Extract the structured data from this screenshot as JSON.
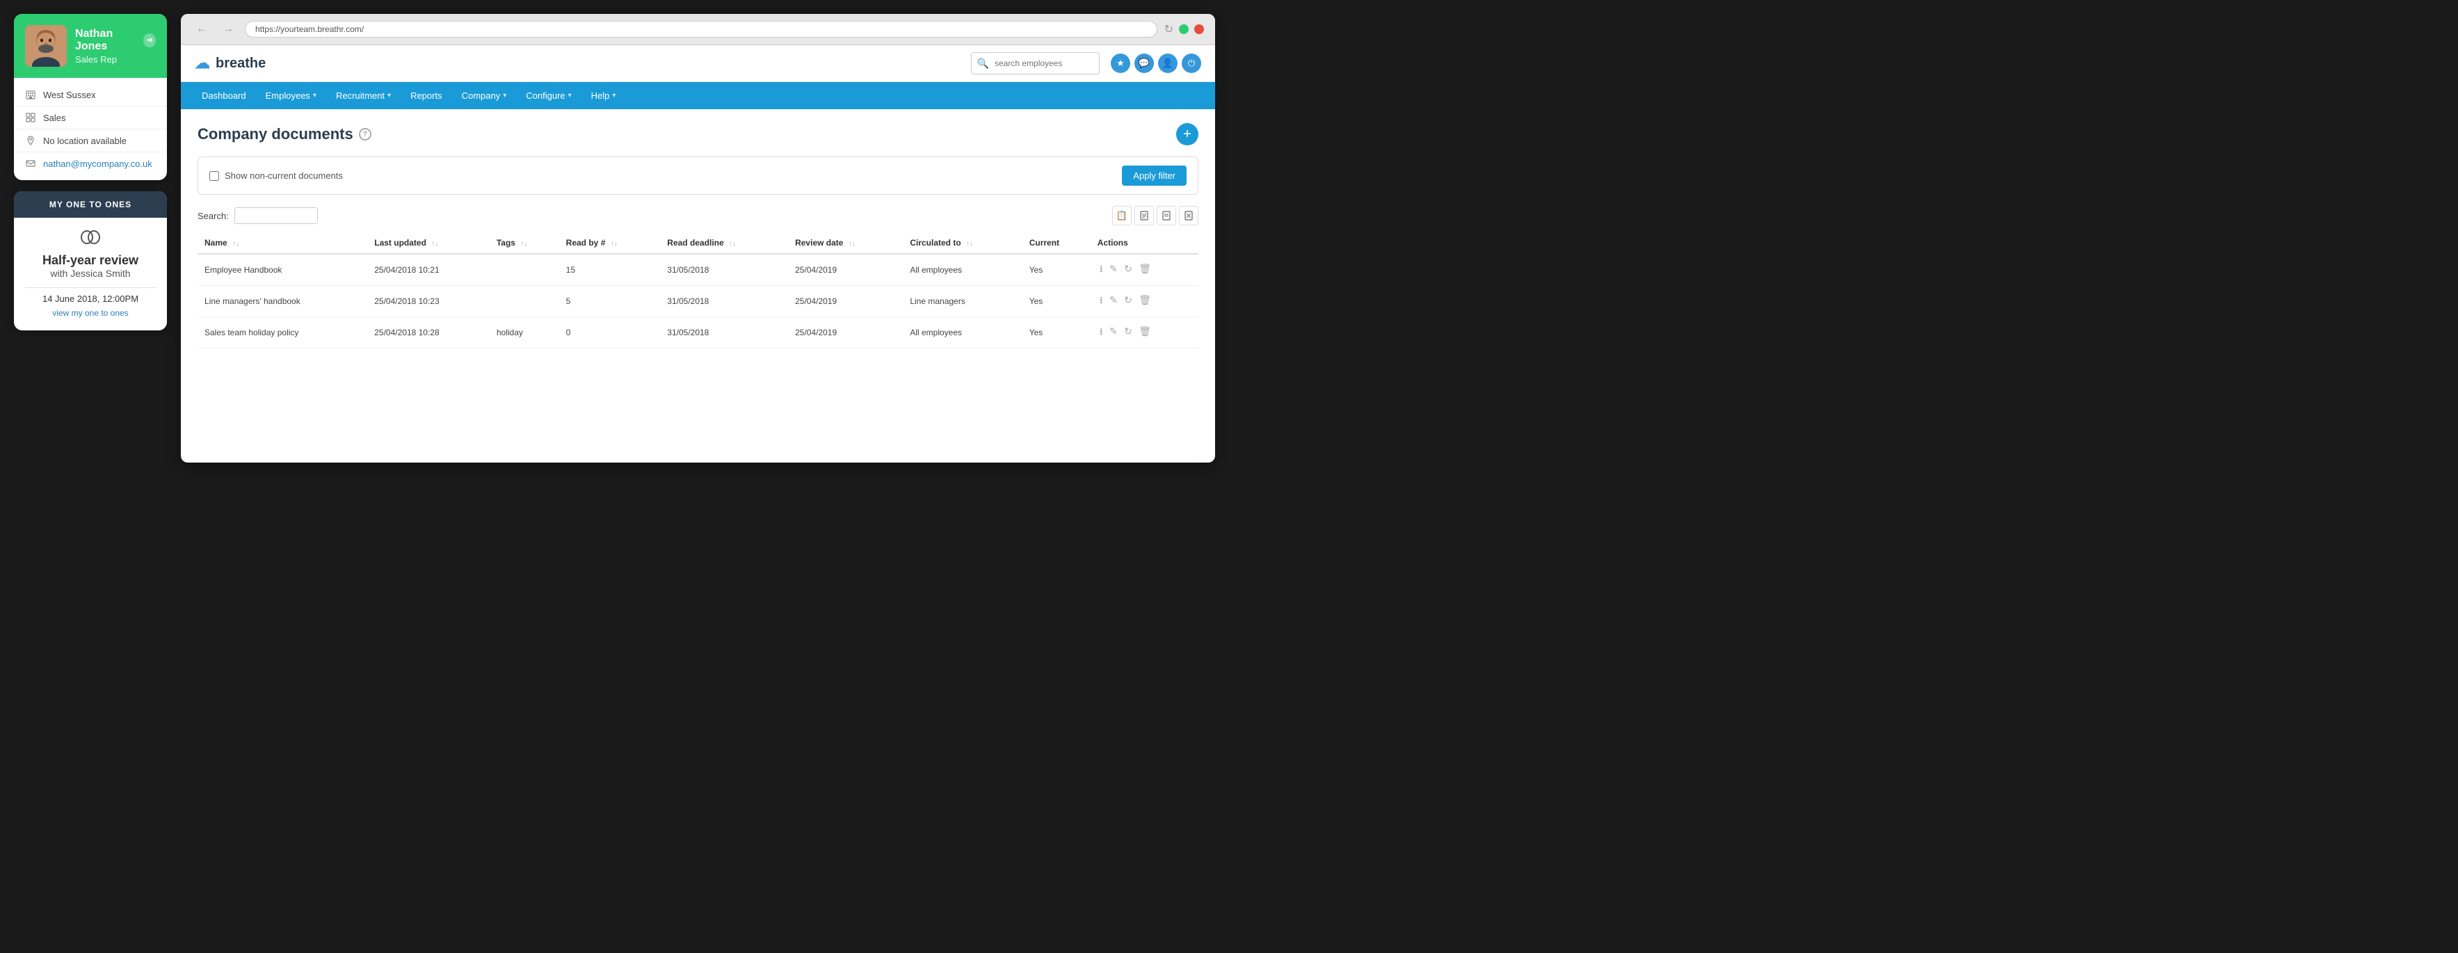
{
  "profile": {
    "name": "Nathan Jones",
    "role": "Sales Rep",
    "department": "West Sussex",
    "team": "Sales",
    "location": "No location available",
    "email": "nathan@mycompany.co.uk",
    "avatar_emoji": "👨"
  },
  "one_to_ones": {
    "section_title": "MY ONE TO ONES",
    "review_title": "Half-year review",
    "review_with": "with Jessica Smith",
    "review_date": "14 June 2018, 12:00PM",
    "view_link": "view my one to ones"
  },
  "browser": {
    "url": "https://yourteam.breathr.com/",
    "app_name": "breathe"
  },
  "nav": {
    "items": [
      {
        "label": "Dashboard",
        "has_dropdown": false
      },
      {
        "label": "Employees",
        "has_dropdown": true
      },
      {
        "label": "Recruitment",
        "has_dropdown": true
      },
      {
        "label": "Reports",
        "has_dropdown": false
      },
      {
        "label": "Company",
        "has_dropdown": true
      },
      {
        "label": "Configure",
        "has_dropdown": true
      },
      {
        "label": "Help",
        "has_dropdown": true
      }
    ]
  },
  "page": {
    "title": "Company documents",
    "filter_label": "Show non-current documents",
    "apply_filter_btn": "Apply filter",
    "search_label": "Search:",
    "search_placeholder": ""
  },
  "search_employees_placeholder": "search employees",
  "table": {
    "columns": [
      {
        "label": "Name",
        "sortable": true
      },
      {
        "label": "Last updated",
        "sortable": true
      },
      {
        "label": "Tags",
        "sortable": true
      },
      {
        "label": "Read by #",
        "sortable": true
      },
      {
        "label": "Read deadline",
        "sortable": true
      },
      {
        "label": "Review date",
        "sortable": true
      },
      {
        "label": "Circulated to",
        "sortable": true
      },
      {
        "label": "Current",
        "sortable": false
      },
      {
        "label": "Actions",
        "sortable": false
      }
    ],
    "rows": [
      {
        "name": "Employee Handbook",
        "last_updated": "25/04/2018 10:21",
        "tags": "",
        "read_by": "15",
        "read_deadline": "31/05/2018",
        "review_date": "25/04/2019",
        "circulated_to": "All employees",
        "current": "Yes"
      },
      {
        "name": "Line managers' handbook",
        "last_updated": "25/04/2018 10:23",
        "tags": "",
        "read_by": "5",
        "read_deadline": "31/05/2018",
        "review_date": "25/04/2019",
        "circulated_to": "Line managers",
        "current": "Yes"
      },
      {
        "name": "Sales team holiday policy",
        "last_updated": "25/04/2018 10:28",
        "tags": "holiday",
        "read_by": "0",
        "read_deadline": "31/05/2018",
        "review_date": "25/04/2019",
        "circulated_to": "All employees",
        "current": "Yes"
      }
    ]
  }
}
